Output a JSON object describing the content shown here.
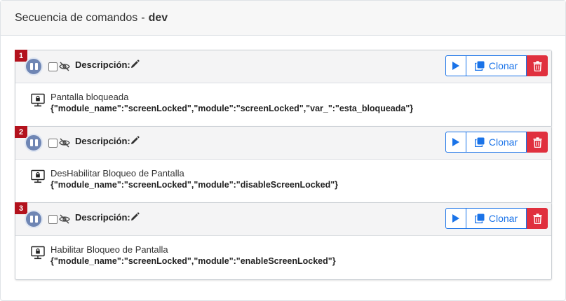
{
  "header": {
    "title": "Secuencia de comandos",
    "separator": "-",
    "environment": "dev"
  },
  "steps": [
    {
      "number": "1",
      "description_label": "Descripción:",
      "clone_label": "Clonar",
      "command_name": "Pantalla bloqueada",
      "command_json": "{\"module_name\":\"screenLocked\",\"module\":\"screenLocked\",\"var_\":\"esta_bloqueada\"}"
    },
    {
      "number": "2",
      "description_label": "Descripción:",
      "clone_label": "Clonar",
      "command_name": "DesHabilitar Bloqueo de Pantalla",
      "command_json": "{\"module_name\":\"screenLocked\",\"module\":\"disableScreenLocked\"}"
    },
    {
      "number": "3",
      "description_label": "Descripción:",
      "clone_label": "Clonar",
      "command_name": "Habilitar Bloqueo de Pantalla",
      "command_json": "{\"module_name\":\"screenLocked\",\"module\":\"enableScreenLocked\"}"
    }
  ],
  "colors": {
    "badge": "#b3121d",
    "primary": "#1a73e8",
    "danger": "#e0303e",
    "pause": "#6f86b4"
  },
  "icons": {
    "pause": "pause-icon",
    "hidden": "eye-slash-icon",
    "edit": "pencil-icon",
    "play": "play-icon",
    "clone": "clone-icon",
    "delete": "trash-icon",
    "command": "monitor-lock-icon"
  }
}
